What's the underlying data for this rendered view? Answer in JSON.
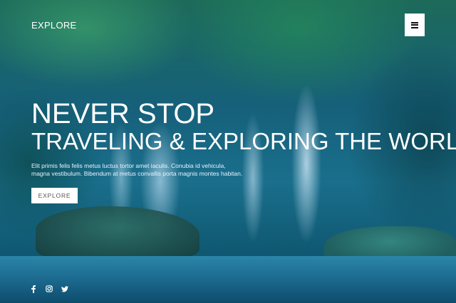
{
  "header": {
    "logo": "EXPLORE",
    "menu_icon": "hamburger-menu-icon"
  },
  "hero": {
    "title_line1": "NEVER STOP",
    "title_line2": "TRAVELING & EXPLORING THE WORLD",
    "description": "Elit primis felis felis metus luctus tortor amet iaculis. Conubia id vehicula, magna vestibulum. Bibendum at metus convallis porta magnis montes habitan.",
    "cta_label": "EXPLORE"
  },
  "social": {
    "icons": [
      "facebook-icon",
      "instagram-icon",
      "twitter-icon"
    ]
  },
  "colors": {
    "text": "#ffffff",
    "button_bg": "#ffffff",
    "button_text": "#555555"
  }
}
